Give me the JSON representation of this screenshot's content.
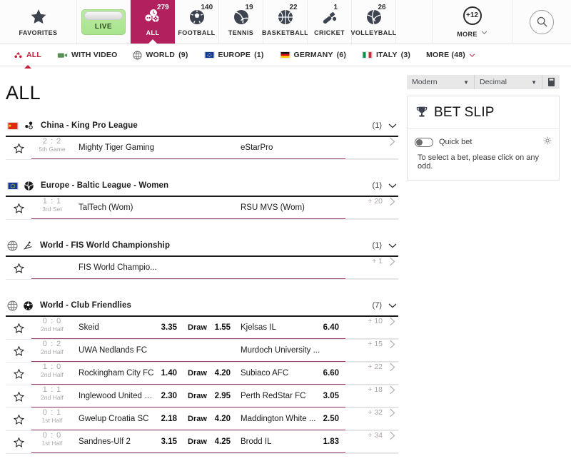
{
  "topnav": {
    "items": [
      {
        "label": "FAVORITES",
        "icon": "star-icon",
        "badge": "",
        "type": "fav"
      },
      {
        "label": "LIVE",
        "icon": "live-button",
        "badge": "",
        "type": "live"
      },
      {
        "label": "ALL",
        "icon": "all-sports-icon",
        "badge": "279",
        "type": "all",
        "active": true
      },
      {
        "label": "FOOTBALL",
        "icon": "football-icon",
        "badge": "140",
        "type": "sport"
      },
      {
        "label": "TENNIS",
        "icon": "tennis-icon",
        "badge": "19",
        "type": "sport"
      },
      {
        "label": "BASKETBALL",
        "icon": "basketball-icon",
        "badge": "22",
        "type": "sport"
      },
      {
        "label": "CRICKET",
        "icon": "cricket-icon",
        "badge": "1",
        "type": "sport"
      },
      {
        "label": "VOLLEYBALL",
        "icon": "volleyball-icon",
        "badge": "26",
        "type": "sport"
      }
    ],
    "more_label": "MORE",
    "more_badge": "+12",
    "search_icon": "search-icon"
  },
  "filterbar": {
    "items": [
      {
        "label": "ALL",
        "count": "",
        "icon": "all-filter-icon",
        "active": true
      },
      {
        "label": "WITH VIDEO",
        "count": "",
        "icon": "video-icon",
        "active": false
      },
      {
        "label": "WORLD",
        "count": "(9)",
        "icon": "globe-icon",
        "active": false
      },
      {
        "label": "EUROPE",
        "count": "(1)",
        "icon": "eu-flag",
        "active": false
      },
      {
        "label": "GERMANY",
        "count": "(6)",
        "icon": "de-flag",
        "active": false
      },
      {
        "label": "ITALY",
        "count": "(3)",
        "icon": "it-flag",
        "active": false
      },
      {
        "label": "MORE (48)",
        "count": "",
        "icon": "chevron-down-icon",
        "active": false
      }
    ]
  },
  "main": {
    "page_title": "ALL",
    "leagues": [
      {
        "name": "China - King Pro League",
        "flag": "cn",
        "sport_icon": "esports-icon",
        "count": "(1)",
        "matches": [
          {
            "score": "2 : 2",
            "period": "5th Game",
            "home": "Mighty Tiger Gaming",
            "home_odd": "",
            "draw_label": "",
            "draw_odd": "",
            "away": "eStarPro",
            "away_odd": "",
            "more": ""
          }
        ]
      },
      {
        "name": "Europe - Baltic League - Women",
        "flag": "eu",
        "sport_icon": "volleyball-icon",
        "count": "(1)",
        "matches": [
          {
            "score": "1 : 1",
            "period": "3rd Set",
            "home": "TalTech (Wom)",
            "home_odd": "",
            "draw_label": "",
            "draw_odd": "",
            "away": "RSU MVS (Wom)",
            "away_odd": "",
            "more": "+ 20"
          }
        ]
      },
      {
        "name": "World - FIS World Championship",
        "flag": "world",
        "sport_icon": "ski-icon",
        "count": "(1)",
        "matches": [
          {
            "score": "",
            "period": "",
            "home": "FIS World Champio...",
            "home_odd": "",
            "draw_label": "",
            "draw_odd": "",
            "away": "",
            "away_odd": "",
            "more": "+ 1"
          }
        ]
      },
      {
        "name": "World - Club Friendlies",
        "flag": "world",
        "sport_icon": "football-icon",
        "count": "(7)",
        "matches": [
          {
            "score": "0 : 0",
            "period": "2nd Half",
            "home": "Skeid",
            "home_odd": "3.35",
            "draw_label": "Draw",
            "draw_odd": "1.55",
            "away": "Kjelsas IL",
            "away_odd": "6.40",
            "more": "+ 10"
          },
          {
            "score": "0 : 2",
            "period": "2nd Half",
            "home": "UWA Nedlands FC",
            "home_odd": "",
            "draw_label": "",
            "draw_odd": "",
            "away": "Murdoch University ...",
            "away_odd": "",
            "more": "+ 15"
          },
          {
            "score": "1 : 0",
            "period": "2nd Half",
            "home": "Rockingham City FC",
            "home_odd": "1.40",
            "draw_label": "Draw",
            "draw_odd": "4.20",
            "away": "Subiaco AFC",
            "away_odd": "6.60",
            "more": "+ 22"
          },
          {
            "score": "1 : 1",
            "period": "2nd Half",
            "home": "Inglewood United SC",
            "home_odd": "2.30",
            "draw_label": "Draw",
            "draw_odd": "2.95",
            "away": "Perth RedStar FC",
            "away_odd": "3.05",
            "more": "+ 18"
          },
          {
            "score": "0 : 1",
            "period": "1st Half",
            "home": "Gwelup Croatia SC",
            "home_odd": "2.18",
            "draw_label": "Draw",
            "draw_odd": "4.20",
            "away": "Maddington White ...",
            "away_odd": "2.50",
            "more": "+ 32"
          },
          {
            "score": "0 : 0",
            "period": "1st Half",
            "home": "Sandnes-Ulf 2",
            "home_odd": "3.15",
            "draw_label": "Draw",
            "draw_odd": "4.25",
            "away": "Brodd IL",
            "away_odd": "1.83",
            "more": "+ 34"
          }
        ]
      }
    ]
  },
  "rightpanel": {
    "view_select": "Modern",
    "odds_select": "Decimal",
    "print_icon": "print-icon",
    "slip_title": "BET SLIP",
    "slip_icon": "trophy-icon",
    "quick_bet_label": "Quick bet",
    "settings_icon": "gear-icon",
    "empty_message": "To select a bet, please click on any odd."
  },
  "colors": {
    "accent": "#b3205e",
    "filter_active": "#c41e3a",
    "live_green": "#a9e58d",
    "underline": "#9c3f6d"
  }
}
